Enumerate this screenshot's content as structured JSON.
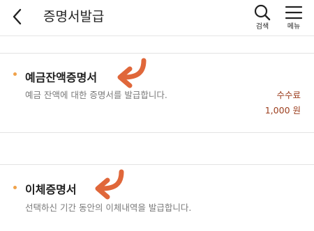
{
  "header": {
    "title": "증명서발급",
    "search_label": "검색",
    "menu_label": "메뉴"
  },
  "colors": {
    "accent_dot": "#f0a24a",
    "fee_text": "#9b3d1c",
    "arrow": "#e0673a"
  },
  "items": [
    {
      "title": "예금잔액증명서",
      "description": "예금 잔액에 대한 증명서를 발급합니다.",
      "fee_label": "수수료",
      "fee_amount": "1,000 원"
    },
    {
      "title": "이체증명서",
      "description": "선택하신 기간 동안의 이체내역을 발급합니다."
    }
  ]
}
